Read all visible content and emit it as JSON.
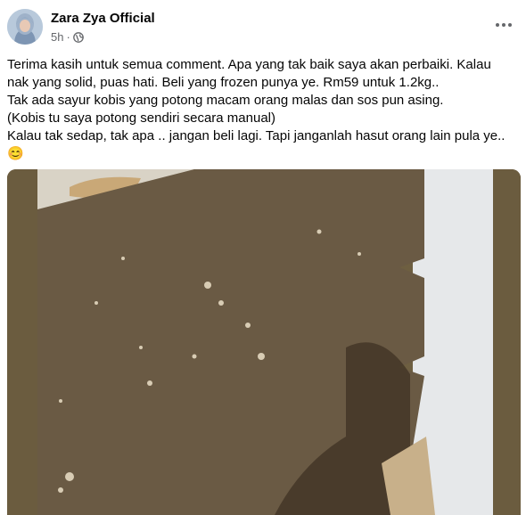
{
  "post": {
    "author": "Zara Zya Official",
    "time": "5h",
    "separator": "·",
    "audience_icon": "globe-icon",
    "more_icon": "more-options-icon",
    "text_lines": [
      "Terima kasih untuk semua comment. Apa yang tak baik saya akan perbaiki. Kalau",
      "nak yang solid, puas hati. Beli yang frozen punya ye. Rm59 untuk 1.2kg..",
      "Tak ada sayur kobis yang potong macam orang malas dan sos pun asing.",
      "(Kobis tu saya potong sendiri secara manual)",
      "Kalau tak sedap, tak apa .. jangan beli lagi. Tapi janganlah hasut orang lain pula ye.."
    ],
    "emoji": "😊"
  },
  "colors": {
    "name": "#050505",
    "meta": "#65676b",
    "photo_background": "#70603f",
    "cardboard": "#6a5a44",
    "tablecloth": "#e9ebee"
  }
}
